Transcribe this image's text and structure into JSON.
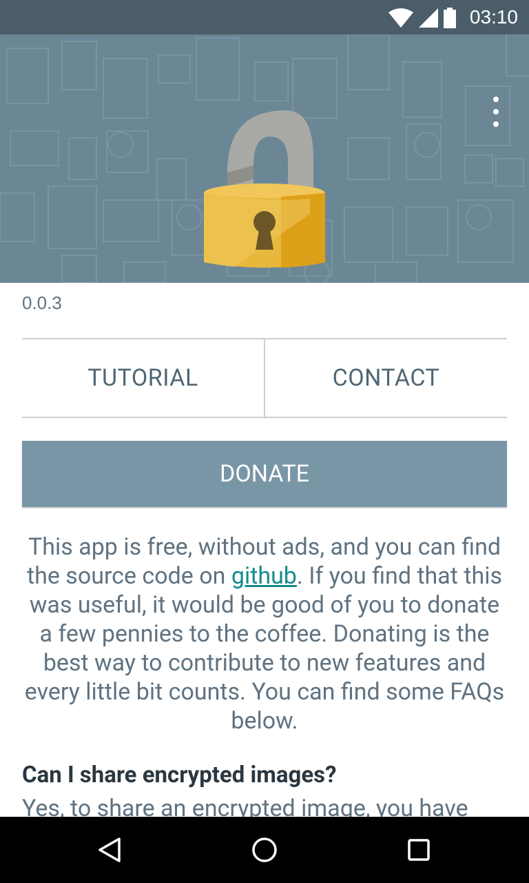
{
  "status_bar": {
    "time": "03:10",
    "icons": [
      "wifi-icon",
      "signal-icon",
      "battery-icon"
    ]
  },
  "header": {
    "image": "unlocked-padlock-icon",
    "menu_icon": "more-vert-icon",
    "background_color": "#6b8796"
  },
  "version": "0.0.3",
  "buttons": {
    "tutorial": "TUTORIAL",
    "contact": "CONTACT",
    "donate": "DONATE"
  },
  "about": {
    "text_before_link": "This app is free, without ads, and you can find the source code on ",
    "link_text": "github",
    "text_after_link": ". If you find that this was useful, it would be good of you to donate a few pennies to the coffee. Donating is the best way to contribute to new features and every little bit counts. You can find some FAQs below."
  },
  "faq": {
    "question": "Can I share encrypted images?",
    "answer_start": "Yes, to share an encrypted image, you have"
  },
  "nav_bar": {
    "back": "back-icon",
    "home": "home-icon",
    "recents": "recents-icon"
  },
  "colors": {
    "accent": "#7996a6",
    "link": "#168b8b",
    "lock_body": "#e8b83c",
    "lock_shackle": "#a9a9a5"
  }
}
